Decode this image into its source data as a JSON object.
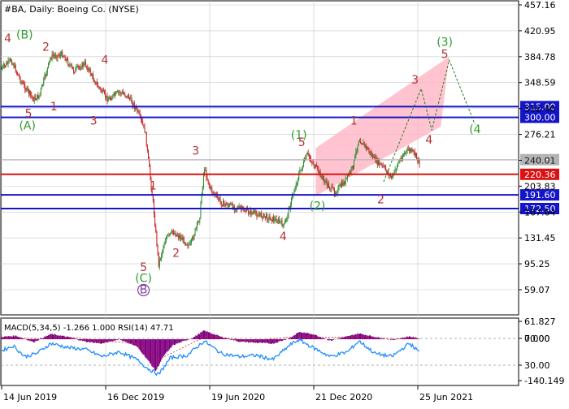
{
  "header": {
    "symbol": "#BA",
    "period": "Daily:",
    "company": "Boeing Co. (NYSE)"
  },
  "macd_header": "MACD(5,34,5) -1.266 1.000 RSI(14) 47.71",
  "colors": {
    "grid": "#c8c8c8",
    "bull": "#2e8b2e",
    "bear": "#cc2222",
    "level_blue": "#1414c8",
    "level_red": "#dd1111",
    "price_gray": "#b4b4b4",
    "zone_pink": "#ffb0c0",
    "wave_green": "#2f9a2f",
    "wave_red": "#b43232",
    "macd_purple": "#800080",
    "rsi_blue": "#1e8cff"
  },
  "chart_data": [
    {
      "type": "line",
      "title": "#BA, Daily: Boeing Co. (NYSE)",
      "price_axis_labels": [
        "457.16",
        "420.95",
        "384.78",
        "348.59",
        "312.40",
        "276.21",
        "240.01",
        "203.83",
        "167.64",
        "131.45",
        "95.25",
        "59.07"
      ],
      "ylim": [
        45,
        470
      ],
      "time_axis_labels": [
        "14 Jun 2019",
        "16 Dec 2019",
        "19 Jun 2020",
        "21 Dec 2020",
        "25 Jun 2021"
      ],
      "price_series": {
        "name": "BA close",
        "x": [
          "2019-06-14",
          "2019-07-01",
          "2019-07-20",
          "2019-08-10",
          "2019-08-20",
          "2019-09-10",
          "2019-10-01",
          "2019-10-20",
          "2019-11-10",
          "2019-12-01",
          "2019-12-20",
          "2020-01-10",
          "2020-01-25",
          "2020-02-10",
          "2020-02-25",
          "2020-03-10",
          "2020-03-20",
          "2020-04-01",
          "2020-04-15",
          "2020-05-01",
          "2020-05-15",
          "2020-06-01",
          "2020-06-09",
          "2020-06-20",
          "2020-07-10",
          "2020-08-01",
          "2020-08-20",
          "2020-09-10",
          "2020-10-01",
          "2020-10-20",
          "2020-10-30",
          "2020-11-10",
          "2020-11-25",
          "2020-12-10",
          "2020-12-25",
          "2021-01-10",
          "2021-01-28",
          "2021-02-15",
          "2021-03-01",
          "2021-03-12",
          "2021-03-25",
          "2021-04-10",
          "2021-04-25",
          "2021-05-10",
          "2021-05-20",
          "2021-06-01",
          "2021-06-10",
          "2021-06-20",
          "2021-06-28"
        ],
        "values": [
          368,
          380,
          348,
          325,
          330,
          385,
          388,
          365,
          375,
          345,
          325,
          335,
          330,
          310,
          280,
          180,
          95,
          130,
          140,
          130,
          120,
          160,
          230,
          200,
          180,
          175,
          170,
          165,
          160,
          155,
          148,
          180,
          220,
          248,
          230,
          210,
          195,
          210,
          230,
          270,
          258,
          240,
          230,
          215,
          235,
          250,
          255,
          248,
          236
        ]
      },
      "levels": [
        {
          "value": 315.0,
          "label": "315.00",
          "color": "#1414c8"
        },
        {
          "value": 300.0,
          "label": "300.00",
          "color": "#1414c8"
        },
        {
          "value": 220.36,
          "label": "220.36",
          "color": "#dd1111"
        },
        {
          "value": 191.6,
          "label": "191.60",
          "color": "#1414c8"
        },
        {
          "value": 172.5,
          "label": "172.50",
          "color": "#1414c8"
        }
      ],
      "current_price": {
        "value": 240.81,
        "label": "240.81"
      },
      "forecast_zone": {
        "corners": [
          {
            "x": "2020-12-25",
            "y": 257
          },
          {
            "x": "2021-08-20",
            "y": 385
          },
          {
            "x": "2021-08-05",
            "y": 287
          },
          {
            "x": "2020-12-25",
            "y": 190
          }
        ]
      },
      "forecast_path": [
        {
          "x": "2021-04-25",
          "y": 210
        },
        {
          "x": "2021-07-01",
          "y": 340
        },
        {
          "x": "2021-07-20",
          "y": 282
        },
        {
          "x": "2021-08-20",
          "y": 380
        },
        {
          "x": "2021-10-05",
          "y": 290
        }
      ],
      "wave_labels": [
        {
          "text": "4",
          "x": "2019-06-25",
          "y": 405,
          "color": "#b43232"
        },
        {
          "text": "(B)",
          "x": "2019-07-25",
          "y": 410,
          "color": "#2f9a2f"
        },
        {
          "text": "2",
          "x": "2019-09-01",
          "y": 393,
          "color": "#b43232"
        },
        {
          "text": "5",
          "x": "2019-08-01",
          "y": 300,
          "color": "#b43232"
        },
        {
          "text": "(A)",
          "x": "2019-07-30",
          "y": 283,
          "color": "#2f9a2f"
        },
        {
          "text": "1",
          "x": "2019-09-15",
          "y": 310,
          "color": "#b43232"
        },
        {
          "text": "4",
          "x": "2019-12-15",
          "y": 375,
          "color": "#b43232"
        },
        {
          "text": "3",
          "x": "2019-11-25",
          "y": 290,
          "color": "#b43232"
        },
        {
          "text": "1",
          "x": "2020-03-10",
          "y": 199,
          "color": "#b43232"
        },
        {
          "text": "3",
          "x": "2020-05-25",
          "y": 248,
          "color": "#b43232"
        },
        {
          "text": "2",
          "x": "2020-04-20",
          "y": 105,
          "color": "#b43232"
        },
        {
          "text": "5",
          "x": "2020-02-22",
          "y": 85,
          "color": "#b43232"
        },
        {
          "text": "(C)",
          "x": "2020-02-22",
          "y": 70,
          "color": "#2f9a2f"
        },
        {
          "text": "B",
          "x": "2020-02-22",
          "y": 54,
          "color": "#8040a0"
        },
        {
          "text": "4",
          "x": "2020-10-28",
          "y": 128,
          "color": "#b43232"
        },
        {
          "text": "(1)",
          "x": "2020-11-25",
          "y": 270,
          "color": "#2f9a2f"
        },
        {
          "text": "5",
          "x": "2020-11-30",
          "y": 260,
          "color": "#b43232"
        },
        {
          "text": "(2)",
          "x": "2020-12-28",
          "y": 171,
          "color": "#2f9a2f"
        },
        {
          "text": "1",
          "x": "2021-03-03",
          "y": 290,
          "color": "#b43232"
        },
        {
          "text": "2",
          "x": "2021-04-20",
          "y": 180,
          "color": "#b43232"
        },
        {
          "text": "3",
          "x": "2021-06-20",
          "y": 347,
          "color": "#b43232"
        },
        {
          "text": "4",
          "x": "2021-07-15",
          "y": 263,
          "color": "#b43232"
        },
        {
          "text": "(3)",
          "x": "2021-08-12",
          "y": 400,
          "color": "#2f9a2f"
        },
        {
          "text": "5",
          "x": "2021-08-12",
          "y": 383,
          "color": "#b43232"
        },
        {
          "text": "(4",
          "x": "2021-10-05",
          "y": 278,
          "color": "#2f9a2f"
        }
      ]
    },
    {
      "type": "bar",
      "title": "MACD(5,34,5) -1.266 1.000 RSI(14) 47.71",
      "axis_labels": [
        "61.827",
        "70.00",
        "0.000",
        "30.00",
        "-140.149"
      ],
      "ylim": [
        -140.149,
        61.827
      ],
      "histogram_points": [
        {
          "x": "2019-06-14",
          "y": 8
        },
        {
          "x": "2019-07-10",
          "y": 12
        },
        {
          "x": "2019-08-10",
          "y": -10
        },
        {
          "x": "2019-09-10",
          "y": 18
        },
        {
          "x": "2019-10-10",
          "y": 8
        },
        {
          "x": "2019-11-10",
          "y": -8
        },
        {
          "x": "2019-12-10",
          "y": -15
        },
        {
          "x": "2020-01-10",
          "y": 0
        },
        {
          "x": "2020-02-10",
          "y": -25
        },
        {
          "x": "2020-02-25",
          "y": -60
        },
        {
          "x": "2020-03-15",
          "y": -110
        },
        {
          "x": "2020-03-28",
          "y": -60
        },
        {
          "x": "2020-04-15",
          "y": -20
        },
        {
          "x": "2020-05-20",
          "y": 5
        },
        {
          "x": "2020-06-09",
          "y": 30
        },
        {
          "x": "2020-07-10",
          "y": 8
        },
        {
          "x": "2020-08-10",
          "y": -8
        },
        {
          "x": "2020-09-10",
          "y": -12
        },
        {
          "x": "2020-10-10",
          "y": -15
        },
        {
          "x": "2020-11-10",
          "y": 5
        },
        {
          "x": "2020-11-25",
          "y": 25
        },
        {
          "x": "2020-12-20",
          "y": 18
        },
        {
          "x": "2021-01-20",
          "y": -5
        },
        {
          "x": "2021-02-20",
          "y": 10
        },
        {
          "x": "2021-03-12",
          "y": 20
        },
        {
          "x": "2021-04-10",
          "y": 8
        },
        {
          "x": "2021-05-10",
          "y": -3
        },
        {
          "x": "2021-06-10",
          "y": 10
        },
        {
          "x": "2021-06-28",
          "y": 2
        }
      ],
      "signal_points": [
        {
          "x": "2019-06-14",
          "y": 6
        },
        {
          "x": "2019-08-10",
          "y": 2
        },
        {
          "x": "2019-10-10",
          "y": 8
        },
        {
          "x": "2019-12-10",
          "y": -5
        },
        {
          "x": "2020-02-10",
          "y": -15
        },
        {
          "x": "2020-03-20",
          "y": -70
        },
        {
          "x": "2020-05-01",
          "y": -30
        },
        {
          "x": "2020-06-15",
          "y": 12
        },
        {
          "x": "2020-09-01",
          "y": -5
        },
        {
          "x": "2020-11-15",
          "y": 8
        },
        {
          "x": "2021-01-20",
          "y": 6
        },
        {
          "x": "2021-03-15",
          "y": 10
        },
        {
          "x": "2021-05-10",
          "y": 2
        },
        {
          "x": "2021-06-28",
          "y": 1
        }
      ],
      "rsi_points": [
        {
          "x": "2019-06-14",
          "y": 50
        },
        {
          "x": "2019-07-05",
          "y": 58
        },
        {
          "x": "2019-07-25",
          "y": 40
        },
        {
          "x": "2019-08-15",
          "y": 45
        },
        {
          "x": "2019-09-10",
          "y": 62
        },
        {
          "x": "2019-10-10",
          "y": 55
        },
        {
          "x": "2019-11-10",
          "y": 52
        },
        {
          "x": "2019-12-10",
          "y": 40
        },
        {
          "x": "2020-01-10",
          "y": 48
        },
        {
          "x": "2020-02-10",
          "y": 35
        },
        {
          "x": "2020-03-01",
          "y": 20
        },
        {
          "x": "2020-03-20",
          "y": 10
        },
        {
          "x": "2020-04-10",
          "y": 38
        },
        {
          "x": "2020-05-10",
          "y": 42
        },
        {
          "x": "2020-06-09",
          "y": 66
        },
        {
          "x": "2020-07-10",
          "y": 45
        },
        {
          "x": "2020-08-10",
          "y": 40
        },
        {
          "x": "2020-09-10",
          "y": 42
        },
        {
          "x": "2020-10-10",
          "y": 35
        },
        {
          "x": "2020-11-10",
          "y": 60
        },
        {
          "x": "2020-11-25",
          "y": 68
        },
        {
          "x": "2020-12-20",
          "y": 55
        },
        {
          "x": "2021-01-20",
          "y": 40
        },
        {
          "x": "2021-02-20",
          "y": 48
        },
        {
          "x": "2021-03-12",
          "y": 66
        },
        {
          "x": "2021-04-10",
          "y": 45
        },
        {
          "x": "2021-05-10",
          "y": 40
        },
        {
          "x": "2021-06-10",
          "y": 62
        },
        {
          "x": "2021-06-28",
          "y": 47.71
        }
      ]
    }
  ]
}
